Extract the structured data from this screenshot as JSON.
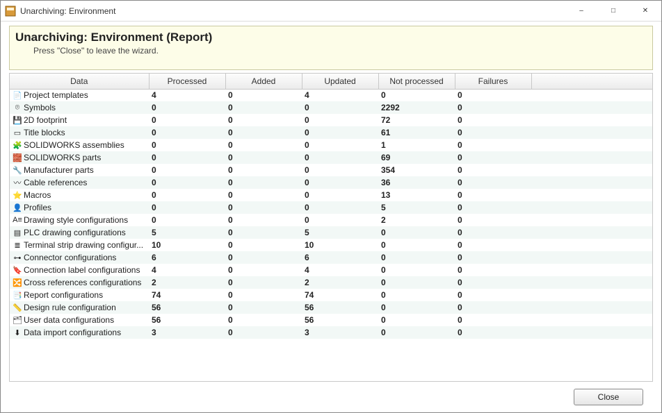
{
  "window": {
    "title": "Unarchiving: Environment"
  },
  "banner": {
    "heading": "Unarchiving: Environment (Report)",
    "hint": "Press \"Close\" to leave the wizard."
  },
  "columns": {
    "data": "Data",
    "processed": "Processed",
    "added": "Added",
    "updated": "Updated",
    "not_processed": "Not processed",
    "failures": "Failures"
  },
  "rows": [
    {
      "icon": "template-icon",
      "label": "Project templates",
      "processed": "4",
      "added": "0",
      "updated": "4",
      "not_processed": "0",
      "failures": "0",
      "bold": true
    },
    {
      "icon": "symbol-icon",
      "label": "Symbols",
      "processed": "0",
      "added": "0",
      "updated": "0",
      "not_processed": "2292",
      "failures": "0",
      "bold": true
    },
    {
      "icon": "footprint-icon",
      "label": "2D footprint",
      "processed": "0",
      "added": "0",
      "updated": "0",
      "not_processed": "72",
      "failures": "0",
      "bold": true
    },
    {
      "icon": "titleblock-icon",
      "label": "Title blocks",
      "processed": "0",
      "added": "0",
      "updated": "0",
      "not_processed": "61",
      "failures": "0",
      "bold": true
    },
    {
      "icon": "sw-asm-icon",
      "label": "SOLIDWORKS assemblies",
      "processed": "0",
      "added": "0",
      "updated": "0",
      "not_processed": "1",
      "failures": "0",
      "bold": true
    },
    {
      "icon": "sw-part-icon",
      "label": "SOLIDWORKS parts",
      "processed": "0",
      "added": "0",
      "updated": "0",
      "not_processed": "69",
      "failures": "0",
      "bold": true
    },
    {
      "icon": "wrench-icon",
      "label": "Manufacturer parts",
      "processed": "0",
      "added": "0",
      "updated": "0",
      "not_processed": "354",
      "failures": "0",
      "bold": true
    },
    {
      "icon": "cable-icon",
      "label": "Cable references",
      "processed": "0",
      "added": "0",
      "updated": "0",
      "not_processed": "36",
      "failures": "0",
      "bold": true
    },
    {
      "icon": "star-icon",
      "label": "Macros",
      "processed": "0",
      "added": "0",
      "updated": "0",
      "not_processed": "13",
      "failures": "0",
      "bold": true
    },
    {
      "icon": "profile-icon",
      "label": "Profiles",
      "processed": "0",
      "added": "0",
      "updated": "0",
      "not_processed": "5",
      "failures": "0",
      "bold": true
    },
    {
      "icon": "drawstyle-icon",
      "label": "Drawing style configurations",
      "processed": "0",
      "added": "0",
      "updated": "0",
      "not_processed": "2",
      "failures": "0",
      "bold": true
    },
    {
      "icon": "plc-icon",
      "label": "PLC drawing configurations",
      "processed": "5",
      "added": "0",
      "updated": "5",
      "not_processed": "0",
      "failures": "0",
      "bold": true
    },
    {
      "icon": "terminal-icon",
      "label": "Terminal strip drawing configur...",
      "processed": "10",
      "added": "0",
      "updated": "10",
      "not_processed": "0",
      "failures": "0",
      "bold": true
    },
    {
      "icon": "connector-icon",
      "label": "Connector configurations",
      "processed": "6",
      "added": "0",
      "updated": "6",
      "not_processed": "0",
      "failures": "0",
      "bold": true
    },
    {
      "icon": "connlabel-icon",
      "label": "Connection label configurations",
      "processed": "4",
      "added": "0",
      "updated": "4",
      "not_processed": "0",
      "failures": "0",
      "bold": true
    },
    {
      "icon": "crossref-icon",
      "label": "Cross references configurations",
      "processed": "2",
      "added": "0",
      "updated": "2",
      "not_processed": "0",
      "failures": "0",
      "bold": true
    },
    {
      "icon": "report-icon",
      "label": "Report configurations",
      "processed": "74",
      "added": "0",
      "updated": "74",
      "not_processed": "0",
      "failures": "0",
      "bold": true
    },
    {
      "icon": "rule-icon",
      "label": "Design rule configuration",
      "processed": "56",
      "added": "0",
      "updated": "56",
      "not_processed": "0",
      "failures": "0",
      "bold": true
    },
    {
      "icon": "userdata-icon",
      "label": "User data configurations",
      "processed": "56",
      "added": "0",
      "updated": "56",
      "not_processed": "0",
      "failures": "0",
      "bold": true
    },
    {
      "icon": "import-icon",
      "label": "Data import configurations",
      "processed": "3",
      "added": "0",
      "updated": "3",
      "not_processed": "0",
      "failures": "0",
      "bold": true
    }
  ],
  "footer": {
    "close": "Close"
  },
  "icons": {
    "template-icon": "📄",
    "symbol-icon": "⌾",
    "footprint-icon": "💾",
    "titleblock-icon": "▭",
    "sw-asm-icon": "🧩",
    "sw-part-icon": "🧱",
    "wrench-icon": "🔧",
    "cable-icon": "〰",
    "star-icon": "⭐",
    "profile-icon": "👤",
    "drawstyle-icon": "A≡",
    "plc-icon": "▤",
    "terminal-icon": "≣",
    "connector-icon": "⊶",
    "connlabel-icon": "🔖",
    "crossref-icon": "🔀",
    "report-icon": "📑",
    "rule-icon": "📏",
    "userdata-icon": "🗂",
    "import-icon": "⬇"
  }
}
